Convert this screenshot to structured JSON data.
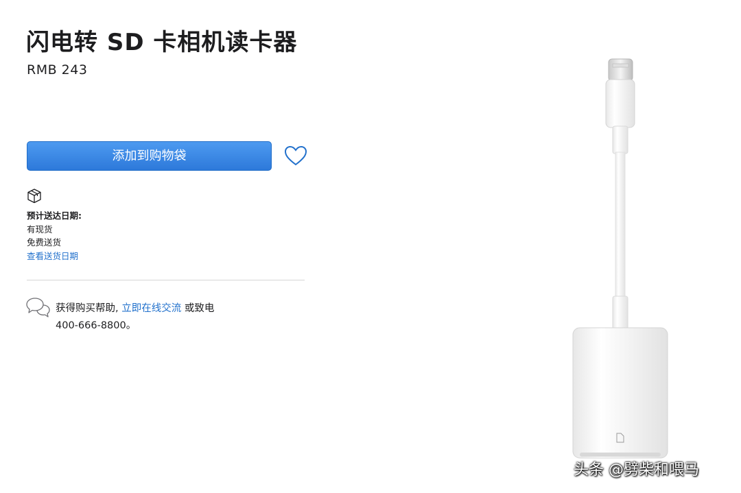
{
  "product": {
    "title": "闪电转 SD 卡相机读卡器",
    "price": "RMB 243"
  },
  "actions": {
    "add_to_bag_label": "添加到购物袋",
    "favorite_icon": "heart-icon"
  },
  "delivery": {
    "icon": "box-icon",
    "label": "预计送达日期:",
    "stock": "有现货",
    "shipping": "免费送货",
    "view_dates_link": "查看送货日期"
  },
  "help": {
    "icon": "chat-bubbles-icon",
    "prefix": "获得购买帮助,",
    "chat_link": "立即在线交流",
    "suffix": "或致电",
    "phone": "400-666-8800。"
  },
  "watermark": "头条 @劈柴和喂马",
  "colors": {
    "button_blue": "#3483e3",
    "link_blue": "#2271cc",
    "text": "#1d1d1f"
  }
}
